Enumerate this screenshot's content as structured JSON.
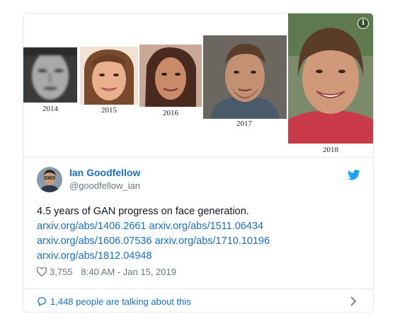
{
  "media": {
    "faces": [
      {
        "year": "2014"
      },
      {
        "year": "2015"
      },
      {
        "year": "2016"
      },
      {
        "year": "2017"
      },
      {
        "year": "2018"
      }
    ]
  },
  "author": {
    "name": "Ian Goodfellow",
    "handle": "@goodfellow_ian"
  },
  "tweet": {
    "text": "4.5 years of GAN progress on face generation.",
    "links": [
      "arxiv.org/abs/1406.2661",
      "arxiv.org/abs/1511.06434",
      "arxiv.org/abs/1606.07536",
      "arxiv.org/abs/1710.10196",
      "arxiv.org/abs/1812.04948"
    ]
  },
  "meta": {
    "likes": "3,755",
    "timestamp": "8:40 AM - Jan 15, 2019"
  },
  "footer": {
    "talking": "1,448 people are talking about this"
  },
  "colors": {
    "link": "#1b6fc4",
    "twitter_blue": "#1da1f2",
    "muted": "#657786"
  },
  "icons": [
    "info-icon",
    "twitter-bird-icon",
    "heart-icon",
    "comment-bubble-icon",
    "chevron-right-icon"
  ]
}
